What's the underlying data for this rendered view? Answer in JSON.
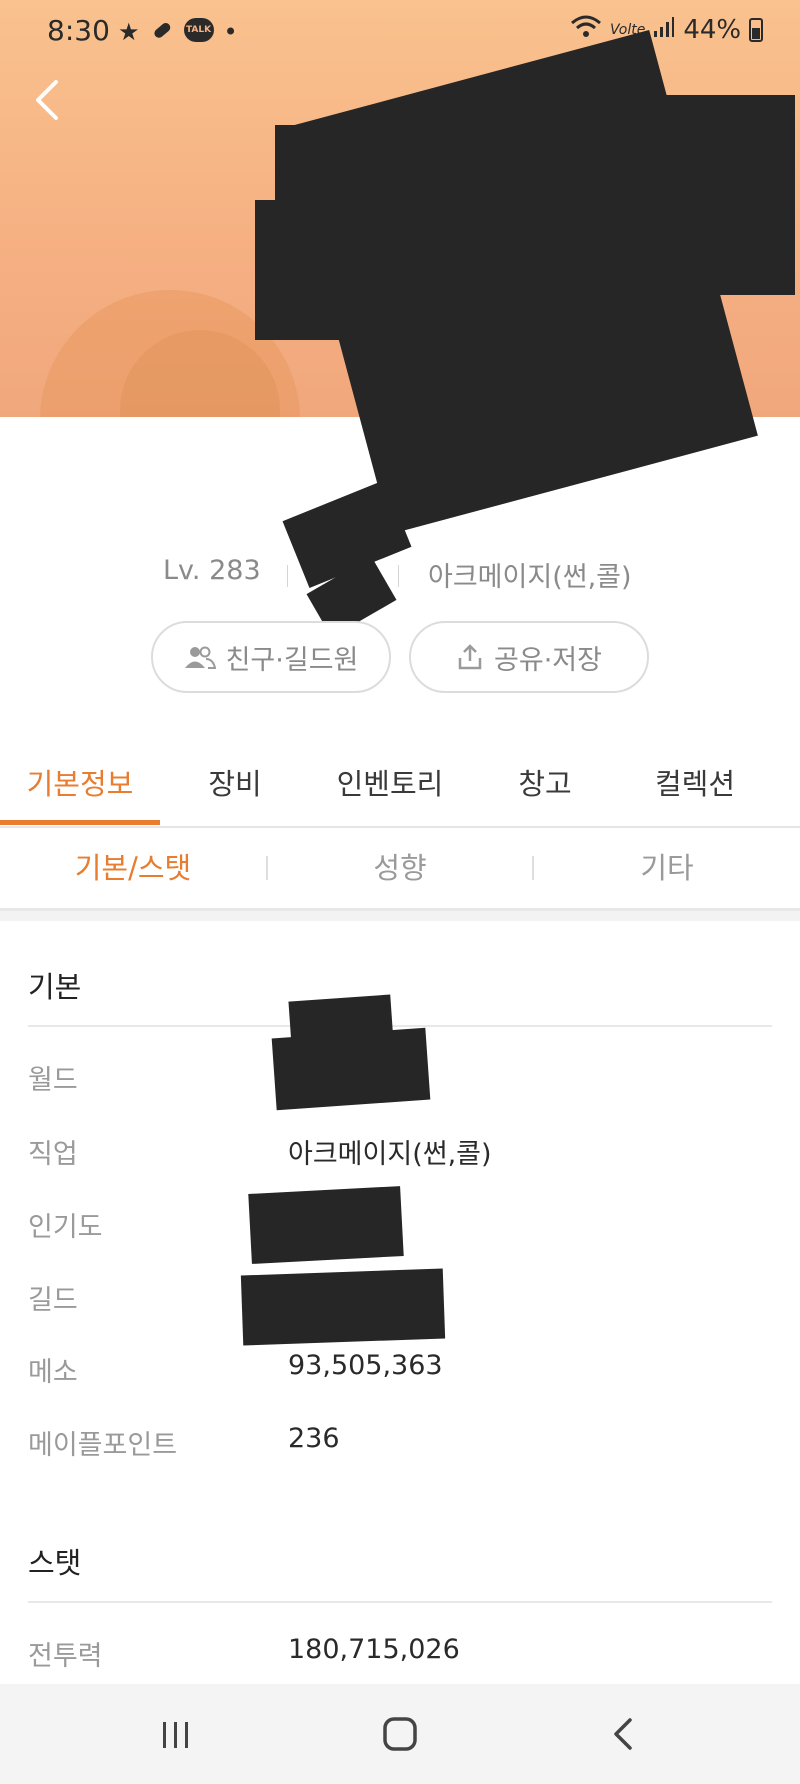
{
  "status_bar": {
    "time": "8:30",
    "talk_badge": "TALK",
    "volte": "Volte",
    "battery": "44%"
  },
  "profile": {
    "level": "Lv. 283",
    "job": "아크메이지(썬,콜)"
  },
  "actions": {
    "friends_guild": "친구·길드원",
    "share_save": "공유·저장"
  },
  "tabs": [
    "기본정보",
    "장비",
    "인벤토리",
    "창고",
    "컬렉션"
  ],
  "active_tab": "기본정보",
  "subtabs": [
    "기본/스탯",
    "성향",
    "기타"
  ],
  "active_subtab": "기본/스탯",
  "basic": {
    "title": "기본",
    "rows": [
      {
        "label": "월드",
        "value": ""
      },
      {
        "label": "직업",
        "value": "아크메이지(썬,콜)"
      },
      {
        "label": "인기도",
        "value": ""
      },
      {
        "label": "길드",
        "value": ""
      },
      {
        "label": "메소",
        "value": "93,505,363"
      },
      {
        "label": "메이플포인트",
        "value": "236"
      }
    ]
  },
  "stats": {
    "title": "스탯",
    "rows": [
      {
        "label": "전투력",
        "value": "180,715,026"
      }
    ]
  },
  "colors": {
    "accent": "#e87c2f",
    "header_bg": "#f6b183",
    "redaction": "#262626"
  }
}
